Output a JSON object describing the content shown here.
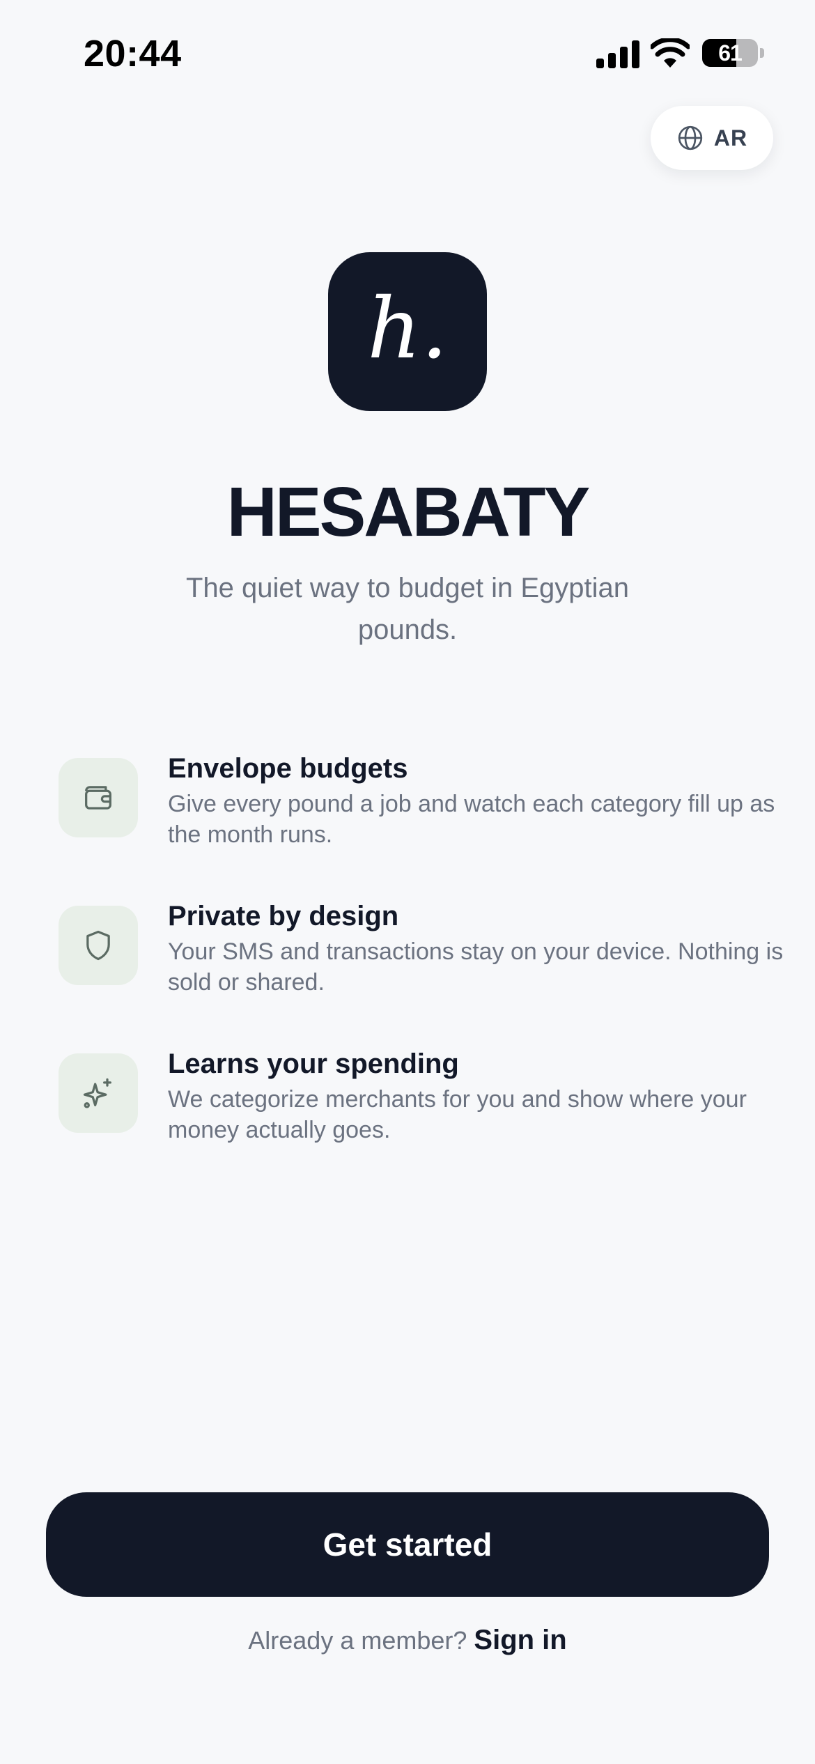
{
  "status_bar": {
    "time": "20:44",
    "battery_level": 61,
    "battery_text": "61"
  },
  "language_toggle": {
    "label": "AR",
    "icon": "globe-icon"
  },
  "brand": {
    "logo_mark": "h.",
    "name": "HESABATY",
    "tagline": "The quiet way to budget in Egyptian pounds."
  },
  "features": [
    {
      "icon": "wallet-icon",
      "title": "Envelope budgets",
      "description": "Give every pound a job and watch each category fill up as the month runs."
    },
    {
      "icon": "shield-icon",
      "title": "Private by design",
      "description": "Your SMS and transactions stay on your device. Nothing is sold or shared."
    },
    {
      "icon": "sparkles-icon",
      "title": "Learns your spending",
      "description": "We categorize merchants for you and show where your money actually goes."
    }
  ],
  "actions": {
    "primary_label": "Get started",
    "signin_prompt": "Already a member?",
    "signin_link": "Sign in"
  },
  "colors": {
    "background": "#f7f8fa",
    "primary": "#121828",
    "icon_tile": "#e8efe8",
    "muted_text": "#6b7280"
  }
}
